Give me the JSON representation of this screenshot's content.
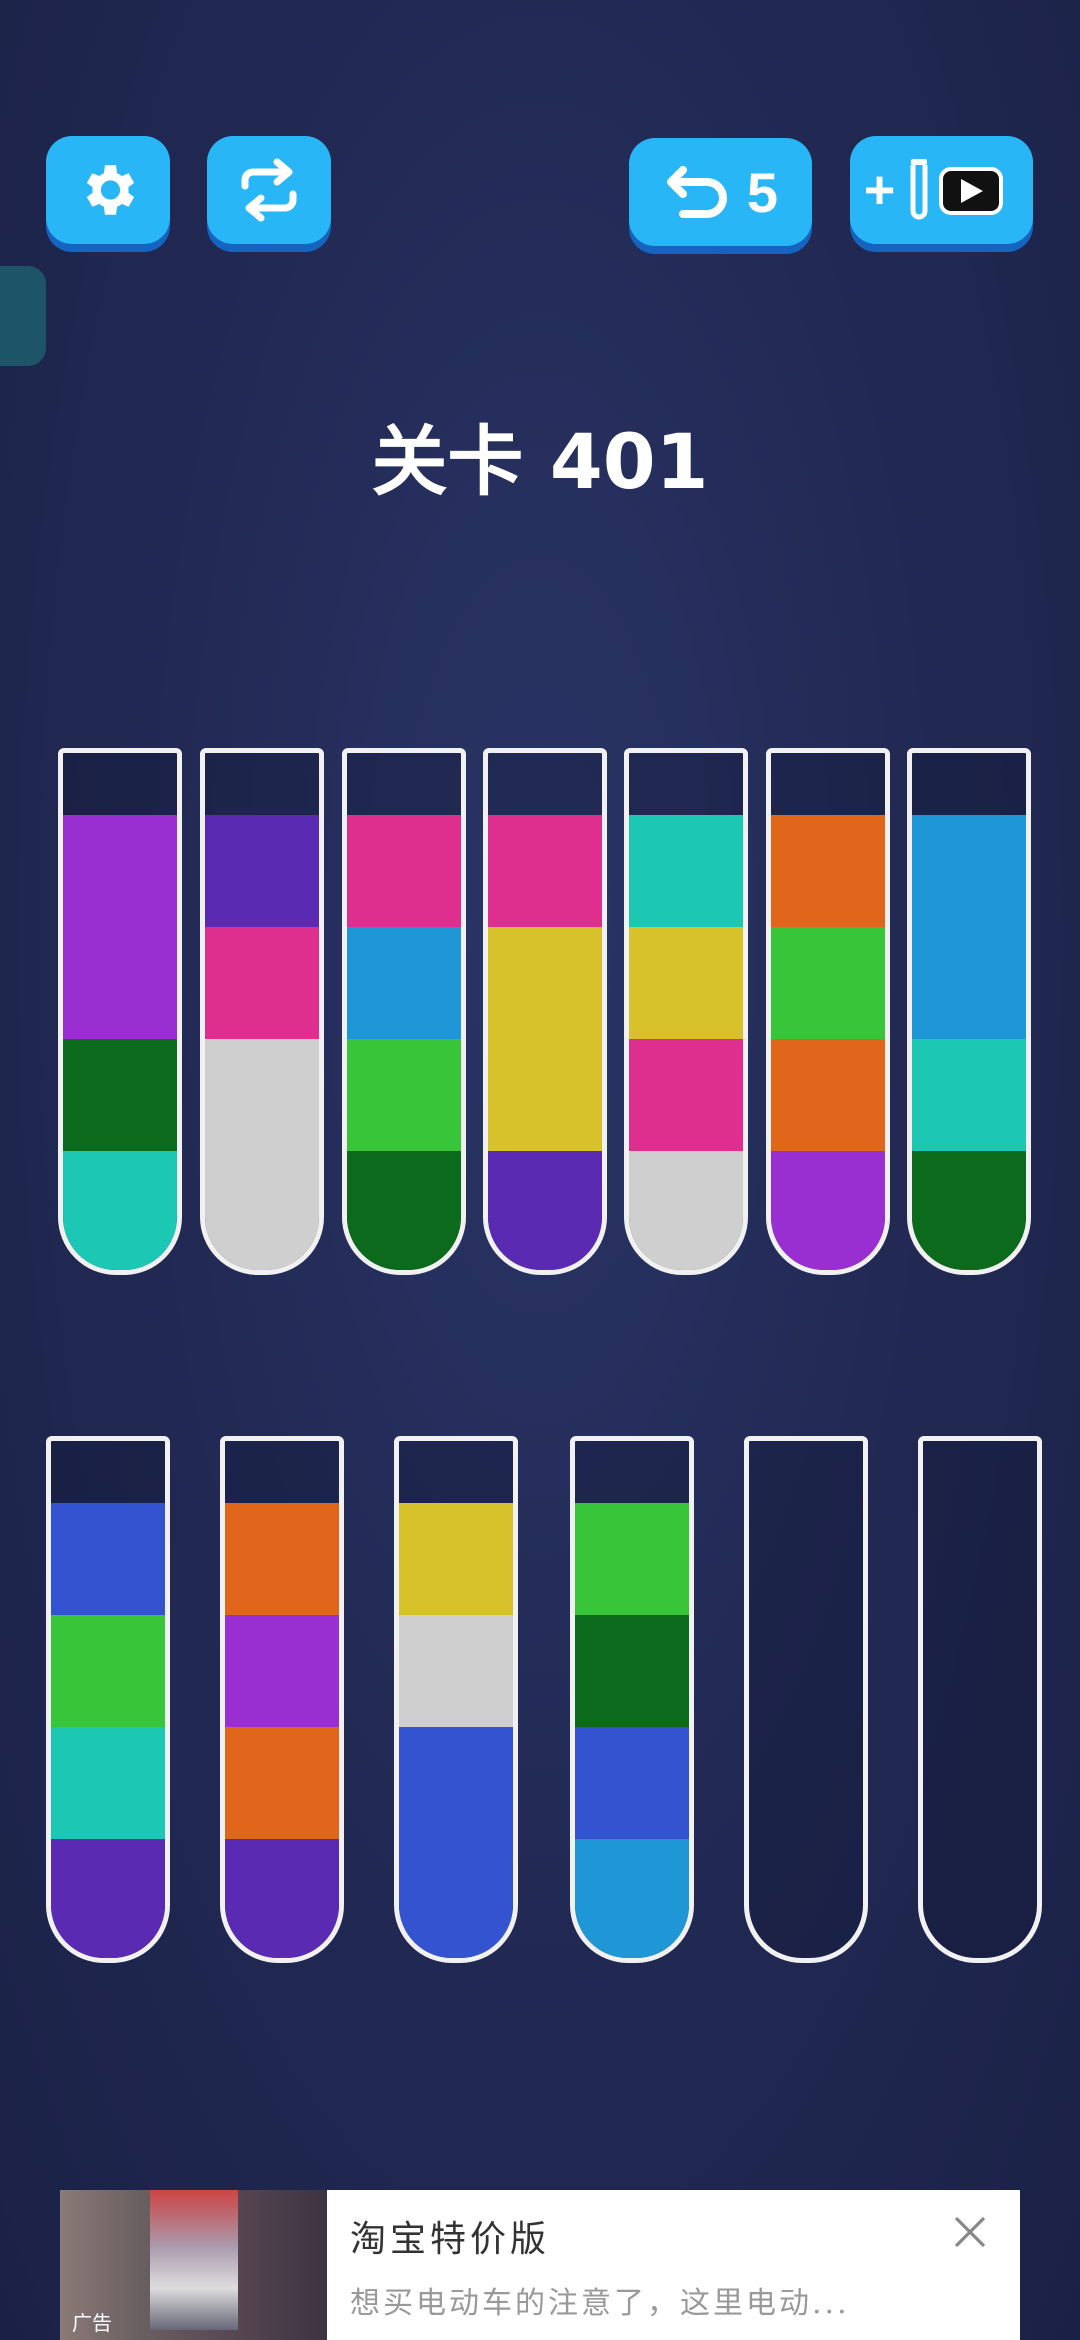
{
  "toolbar": {
    "settings_icon": "gear-icon",
    "shuffle_icon": "shuffle-icon",
    "undo_icon": "undo-icon",
    "undo_count": "5",
    "add_tube_plus": "+",
    "add_tube_icon": "tube-video-icon"
  },
  "level": {
    "title": "关卡 401"
  },
  "colors": {
    "purple": "#9a2fd1",
    "indigo": "#5a2ab3",
    "pink": "#de2f8f",
    "teal": "#1cc7b4",
    "orange": "#e0661b",
    "sky": "#1f96d6",
    "darkgreen": "#0b6a1c",
    "white": "#cfcfcf",
    "lime": "#39c53a",
    "yellow": "#d8c22b",
    "blue": "#3453d1"
  },
  "tubes": [
    [
      "purple",
      "purple",
      "darkgreen",
      "teal"
    ],
    [
      "indigo",
      "pink",
      "white",
      "white"
    ],
    [
      "pink",
      "sky",
      "lime",
      "darkgreen"
    ],
    [
      "pink",
      "yellow",
      "yellow",
      "indigo"
    ],
    [
      "teal",
      "yellow",
      "pink",
      "white"
    ],
    [
      "orange",
      "lime",
      "orange",
      "purple"
    ],
    [
      "sky",
      "sky",
      "teal",
      "darkgreen"
    ],
    [
      "blue",
      "lime",
      "teal",
      "indigo"
    ],
    [
      "orange",
      "purple",
      "orange",
      "indigo"
    ],
    [
      "yellow",
      "white",
      "blue",
      "blue"
    ],
    [
      "lime",
      "darkgreen",
      "blue",
      "sky"
    ],
    [],
    []
  ],
  "ad": {
    "title": "淘宝特价版",
    "description": "想买电动车的注意了，这里电动...",
    "logo_text": "广告"
  }
}
